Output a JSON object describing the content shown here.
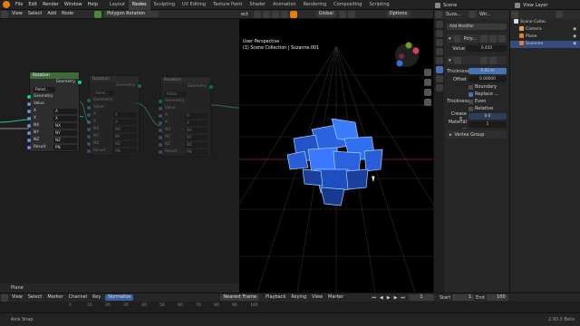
{
  "topbar": {
    "menus": [
      "File",
      "Edit",
      "Render",
      "Window",
      "Help"
    ],
    "workspaces": [
      "Layout",
      "Nodes",
      "Sculpting",
      "UV Editing",
      "Texture Paint",
      "Shader",
      "Animation",
      "Rendering",
      "Compositing",
      "Scripting"
    ],
    "active_workspace": "Nodes",
    "scene": "Scene",
    "view_layer": "View Layer"
  },
  "node_editor": {
    "menus": [
      "View",
      "Select",
      "Add",
      "Node"
    ],
    "tree_name": "Polygon Rotation",
    "footer_label": "Plane",
    "nodes": [
      {
        "title": "Rotation",
        "out": "Geometry",
        "mode": "Rotat...",
        "rows": [
          [
            "Geometry",
            ""
          ],
          [
            "Value",
            ""
          ],
          [
            "A",
            ""
          ],
          [
            "X",
            ""
          ],
          [
            "NX",
            ""
          ],
          [
            "NY",
            ""
          ],
          [
            "NZ",
            ""
          ],
          [
            "Result",
            "PN"
          ]
        ],
        "vals": [
          "A",
          "X",
          "NX",
          "NY",
          "NZ",
          "PN"
        ]
      },
      {
        "title": "Rotation",
        "out": "Geometry",
        "mode": "Rotat...",
        "rows": [
          [
            "Geometry",
            ""
          ],
          [
            "Value",
            ""
          ],
          [
            "A",
            ""
          ],
          [
            "X",
            ""
          ],
          [
            "NX",
            ""
          ],
          [
            "NY",
            ""
          ],
          [
            "NZ",
            ""
          ],
          [
            "Result",
            "PN"
          ]
        ],
        "vals": [
          "A",
          "X",
          "NX",
          "NY",
          "NZ",
          "PN"
        ]
      },
      {
        "title": "Rotation",
        "out": "Geometry",
        "mode": "Rotat...",
        "rows": [
          [
            "Geometry",
            ""
          ],
          [
            "Value",
            ""
          ],
          [
            "A",
            ""
          ],
          [
            "X",
            ""
          ],
          [
            "NX",
            ""
          ],
          [
            "NY",
            ""
          ],
          [
            "NZ",
            ""
          ],
          [
            "Result",
            "PN"
          ]
        ],
        "vals": [
          "A",
          "X",
          "NX",
          "NY",
          "NZ",
          "PN"
        ]
      }
    ]
  },
  "viewport": {
    "mode": "Global",
    "options_label": "Options",
    "perspective": "User Perspective",
    "collection": "(1) Scene Collection | Suzanne.001",
    "header_label": "ect",
    "gizmo": {
      "x": "X",
      "y": "Y",
      "z": "Z"
    }
  },
  "properties": {
    "object": "Suza...",
    "modifier_name": "Wir...",
    "add_modifier": "Add Modifier",
    "mod1": {
      "name": "Poly...",
      "value_label": "Value",
      "value": "0.450"
    },
    "wire": {
      "thickness_label": "Thickness",
      "thickness": "0.02 m",
      "offset_label": "Offset",
      "offset": "0.00000",
      "boundary": "Boundary",
      "replace": "Replace ...",
      "thickness2": "Thickness",
      "even": "Even",
      "relative": "Relative",
      "crease_label": "Crease E...",
      "crease": "0.0",
      "material_label": "Material ...",
      "material": "1",
      "vertex_group": "Vertex Group"
    }
  },
  "outliner": {
    "title": "View Layer",
    "items": [
      "Scene Collec",
      "Camera",
      "Plane",
      "Suzanne"
    ]
  },
  "timeline": {
    "menus": [
      "Playback",
      "Keying",
      "View",
      "Marker"
    ],
    "left_menus": [
      "View",
      "Select",
      "Marker",
      "Channel",
      "Key"
    ],
    "normalize": "Normalize",
    "nearest_frame": "Nearest Frame",
    "frame": "1",
    "start_label": "Start",
    "start": "1",
    "end_label": "End",
    "end": "100",
    "ticks": [
      "0",
      "10",
      "20",
      "30",
      "40",
      "50",
      "60",
      "70",
      "80",
      "90",
      "100"
    ]
  },
  "status": {
    "left": "Axis Snap",
    "version": "2.93.0 Beta"
  }
}
